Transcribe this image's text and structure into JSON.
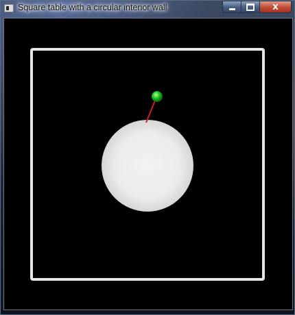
{
  "window": {
    "title": "Square table with a circular interior wall",
    "controls": {
      "minimize_icon": "minimize-icon",
      "maximize_icon": "maximize-icon",
      "close_label": "X"
    }
  },
  "scene": {
    "background_color": "#000000",
    "wall_color": "#e8e8e8",
    "obstacle_color": "#eeeeee",
    "ball_color": "#22cc22",
    "velocity_color": "#cc2222"
  }
}
